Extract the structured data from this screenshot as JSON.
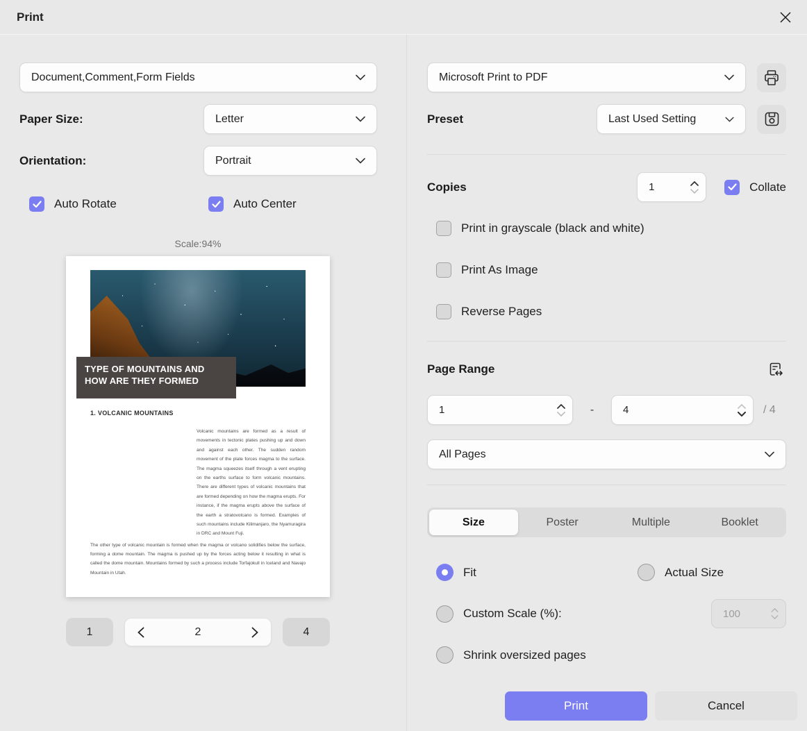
{
  "colors": {
    "accent": "#7b7ef0"
  },
  "titlebar": {
    "title": "Print"
  },
  "left": {
    "content_select": {
      "value": "Document,Comment,Form Fields"
    },
    "paper_size": {
      "label": "Paper Size:",
      "value": "Letter"
    },
    "orientation": {
      "label": "Orientation:",
      "value": "Portrait"
    },
    "auto_rotate": {
      "label": "Auto Rotate",
      "checked": true
    },
    "auto_center": {
      "label": "Auto Center",
      "checked": true
    },
    "scale_text": "Scale:94%",
    "preview": {
      "banner_title": "TYPE OF MOUNTAINS AND HOW ARE THEY FORMED",
      "section_heading": "1. VOLCANIC MOUNTAINS",
      "paragraph_right": "Volcanic mountains are formed as a result of movements in tectonic plates pushing up and down and against each other. The sudden random movement of the plate forces magma to the surface. The magma squeezes itself through a vent erupting on the earths surface to form volcanic mountains. There are different types of volcanic mountains that are formed depending on how the magma erupts. For instance, if the magma erupts above the surface of the earth a stratovolcano is formed. Examples of such mountains include Kilimanjaro, the Nyamuragira in DRC and Mount Fuji.",
      "paragraph_bottom": "The other type of volcanic mountain is formed when the magma or volcano solidifies below the surface, forming a dome mountain. The magma is pushed up by the forces acting below it resulting in what is called the dome mountain. Mountains formed by such a process include Torfajokull in Iceland and Navajo Mountain in Utah."
    },
    "pagination": {
      "first": "1",
      "current": "2",
      "last": "4"
    }
  },
  "right": {
    "printer_select": {
      "value": "Microsoft Print to PDF"
    },
    "preset": {
      "label": "Preset",
      "value": "Last Used Setting"
    },
    "copies": {
      "label": "Copies",
      "value": "1"
    },
    "collate": {
      "label": "Collate",
      "checked": true
    },
    "options": {
      "grayscale": "Print in grayscale (black and white)",
      "print_as_image": "Print As Image",
      "reverse_pages": "Reverse Pages"
    },
    "page_range": {
      "label": "Page Range",
      "from": "1",
      "separator": "-",
      "to": "4",
      "total": "/ 4",
      "pages_select": "All Pages"
    },
    "tabs": [
      {
        "label": "Size"
      },
      {
        "label": "Poster"
      },
      {
        "label": "Multiple"
      },
      {
        "label": "Booklet"
      }
    ],
    "size_options": {
      "fit": "Fit",
      "actual_size": "Actual Size",
      "custom_scale": "Custom Scale (%):",
      "custom_scale_value": "100",
      "shrink": "Shrink oversized pages"
    }
  },
  "footer": {
    "print": "Print",
    "cancel": "Cancel"
  }
}
